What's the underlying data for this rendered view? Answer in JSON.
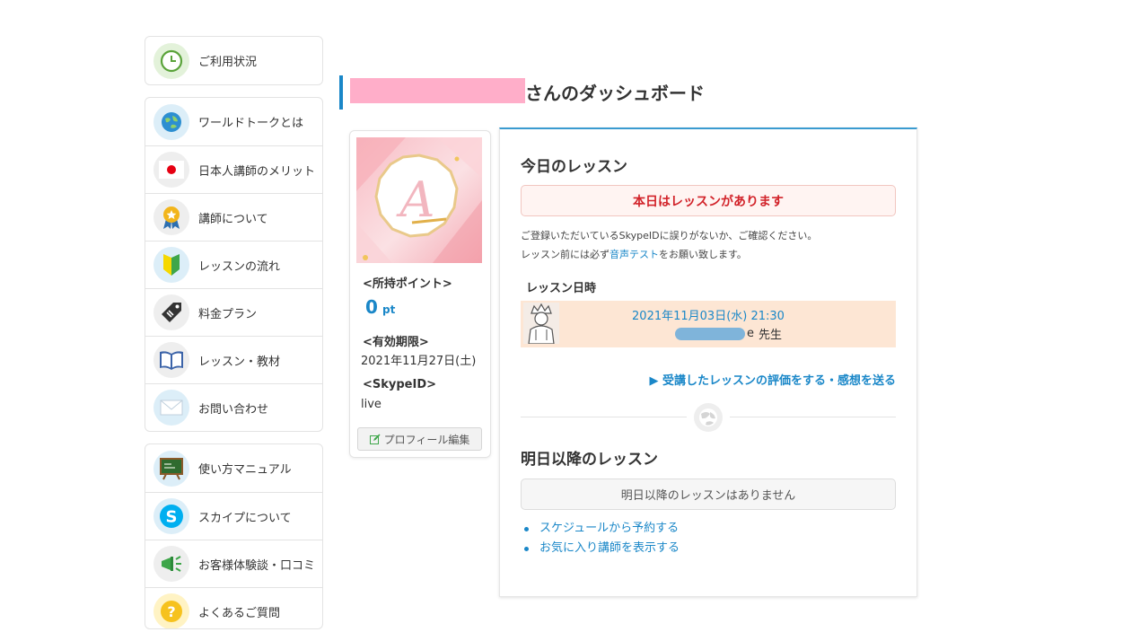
{
  "sidebar": {
    "groups": [
      {
        "items": [
          {
            "label": "ご利用状況",
            "icon": "clock-icon"
          }
        ]
      },
      {
        "items": [
          {
            "label": "ワールドトークとは",
            "icon": "globe-icon"
          },
          {
            "label": "日本人講師のメリット",
            "icon": "japan-flag-icon"
          },
          {
            "label": "講師について",
            "icon": "award-badge-icon"
          },
          {
            "label": "レッスンの流れ",
            "icon": "beginner-mark-icon"
          },
          {
            "label": "料金プラン",
            "icon": "price-tag-icon"
          },
          {
            "label": "レッスン・教材",
            "icon": "open-book-icon"
          },
          {
            "label": "お問い合わせ",
            "icon": "envelope-icon"
          }
        ]
      },
      {
        "items": [
          {
            "label": "使い方マニュアル",
            "icon": "chalkboard-icon"
          },
          {
            "label": "スカイプについて",
            "icon": "skype-icon"
          },
          {
            "label": "お客様体験談・口コミ",
            "icon": "megaphone-icon"
          },
          {
            "label": "よくあるご質問",
            "icon": "question-icon"
          }
        ]
      }
    ]
  },
  "header": {
    "title_suffix": "さんのダッシュボード"
  },
  "profile": {
    "points_label": "<所持ポイント>",
    "points_value": "0",
    "points_unit": "pt",
    "expiry_label": "<有効期限>",
    "expiry_value": "2021年11月27日(土)",
    "skype_label": "<SkypeID>",
    "skype_value": "live",
    "edit_button": "プロフィール編集"
  },
  "today": {
    "heading": "今日のレッスン",
    "alert": "本日はレッスンがあります",
    "note_line1": "ご登録いただいているSkypeIDに誤りがないか、ご確認ください。",
    "note_line2_prefix": "レッスン前には必ず",
    "note_line2_link": "音声テスト",
    "note_line2_suffix": "をお願い致します。",
    "datetime_label": "レッスン日時",
    "lesson_datetime": "2021年11月03日(水) 21:30",
    "teacher_name_visible": "e",
    "teacher_suffix": "先生",
    "review_link": "▶ 受講したレッスンの評価をする・感想を送る"
  },
  "upcoming": {
    "heading": "明日以降のレッスン",
    "empty_message": "明日以降のレッスンはありません",
    "links": [
      "スケジュールから予約する",
      "お気に入り講師を表示する"
    ]
  },
  "colors": {
    "accent": "#1a87c8",
    "alert_text": "#d2232a",
    "name_mask": "#ffaec9",
    "lesson_row_bg": "#fde6d4"
  }
}
